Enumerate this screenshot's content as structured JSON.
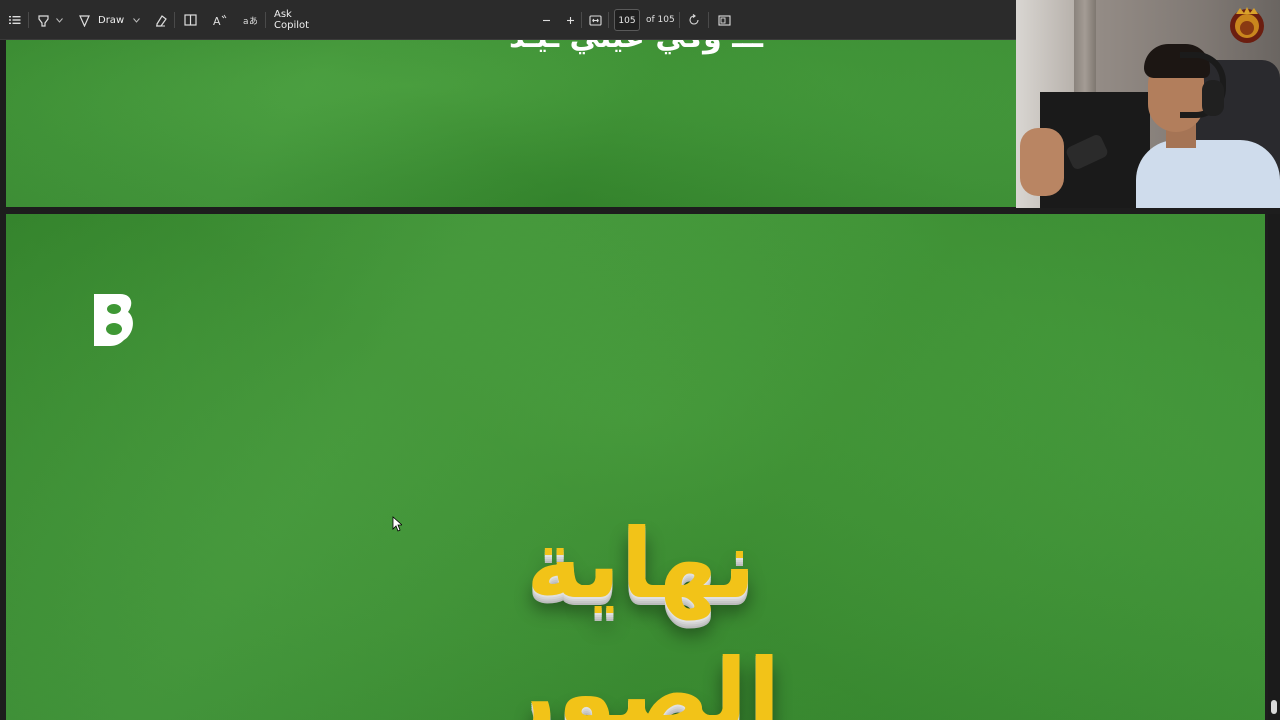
{
  "toolbar": {
    "items": [
      {
        "name": "contents-icon"
      },
      {
        "name": "highlight-icon"
      },
      {
        "name": "draw-icon",
        "label": "Draw"
      },
      {
        "name": "eraser-icon"
      },
      {
        "name": "page-view-icon"
      },
      {
        "name": "read-aloud-icon"
      },
      {
        "name": "translate-icon"
      }
    ],
    "draw_label": "Draw",
    "copilot_label": "Ask Copilot",
    "zoom_out_icon": "minus-icon",
    "zoom_in_icon": "plus-icon",
    "fit_icon": "fit-page-icon",
    "rotate_icon": "rotate-icon",
    "page_current": "105",
    "page_total_label": "of 105",
    "two_page_icon": "two-page-icon"
  },
  "document": {
    "page_top_fragment": "ـــ وكي عيلي ـيـد",
    "page_main_title": "نهاية الصور",
    "logo_icon": "b-logo-icon"
  },
  "colors": {
    "page_green": "#3f9835",
    "title_yellow": "#f2c318",
    "toolbar_bg": "#2b2b2b"
  },
  "webcam": {
    "badge_icon": "lion-badge-icon"
  }
}
